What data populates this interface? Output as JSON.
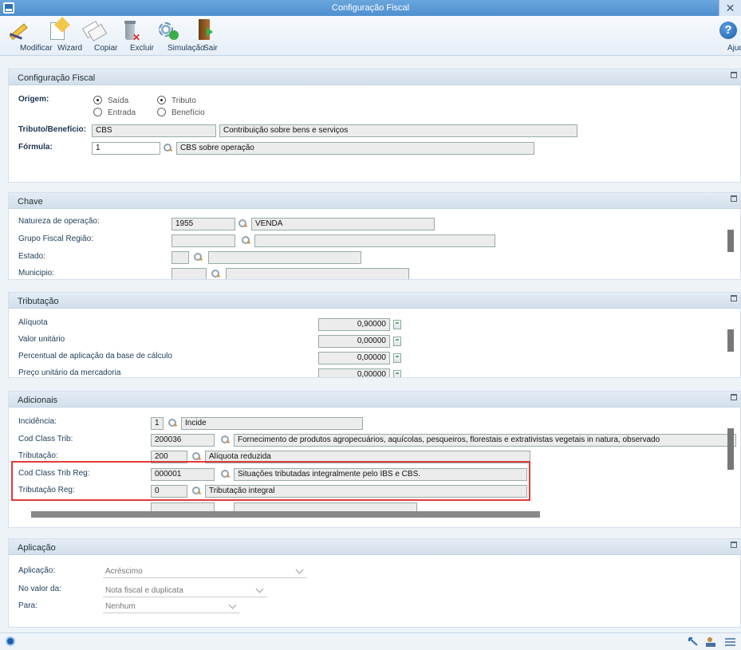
{
  "window": {
    "title": "Configuração Fiscal"
  },
  "toolbar": {
    "buttons": [
      {
        "label": "Modificar",
        "icon": "pencil-icon"
      },
      {
        "label": "Wizard",
        "icon": "wizard-icon"
      },
      {
        "label": "Copiar",
        "icon": "copy-icon"
      },
      {
        "label": "Excluir",
        "icon": "trash-icon"
      },
      {
        "label": "Simulação",
        "icon": "simulation-icon"
      },
      {
        "label": "Sair",
        "icon": "exit-icon"
      }
    ],
    "help_label": "Ajuda"
  },
  "config": {
    "title": "Configuração Fiscal",
    "origem_label": "Origem:",
    "saida": "Saída",
    "entrada": "Entrada",
    "tributo": "Tributo",
    "beneficio": "Benefício",
    "selected_origem": "Saída",
    "selected_tipo": "Tributo",
    "tributo_label": "Tributo/Benefício:",
    "tributo_code": "CBS",
    "tributo_desc": "Contribuição sobre bens e serviços",
    "formula_label": "Fórmula:",
    "formula_code": "1",
    "formula_desc": "CBS sobre operação"
  },
  "chave": {
    "title": "Chave",
    "natureza_label": "Natureza de operação:",
    "natureza_code": "1955",
    "natureza_desc": "VENDA",
    "grupo_label": "Grupo Fiscal Região:",
    "estado_label": "Estado:",
    "municipio_label": "Municipio:"
  },
  "tributacao": {
    "title": "Tributação",
    "aliquota_label": "Alíquota",
    "aliquota": "0,90000",
    "valor_label": "Valor unitário",
    "valor": "0,00000",
    "percentual_label": "Percentual de aplicação da base de cálculo",
    "percentual": "0,00000",
    "preco_label": "Preço unitário da mercadoria",
    "preco": "0,00000"
  },
  "adicionais": {
    "title": "Adicionais",
    "incidencia_label": "Incidência:",
    "incidencia_code": "1",
    "incidencia_desc": "Incide",
    "cod_class_label": "Cod Class Trib:",
    "cod_class_code": "200036",
    "cod_class_desc": "Fornecimento de produtos agropecuários, aquícolas, pesqueiros, florestais e extrativistas vegetais in natura, observado",
    "trib_label": "Tributação:",
    "trib_code": "200",
    "trib_desc": "Alíquota reduzida",
    "cod_class_reg_label": "Cod Class Trib Reg:",
    "cod_class_reg_code": "000001",
    "cod_class_reg_desc": "Situações tributadas integralmente pelo IBS e CBS.",
    "trib_reg_label": "Tributação Reg:",
    "trib_reg_code": "0",
    "trib_reg_desc": "Tributação integral"
  },
  "aplicacao": {
    "title": "Aplicação",
    "aplicacao_label": "Aplicação:",
    "aplicacao_value": "Acréscimo",
    "valor_da_label": "No valor da:",
    "valor_da_value": "Nota fiscal e duplicata",
    "para_label": "Para:",
    "para_value": "Nenhum"
  },
  "colors": {
    "title_bar": "#4f8fcf",
    "highlight": "#e23a3a"
  }
}
